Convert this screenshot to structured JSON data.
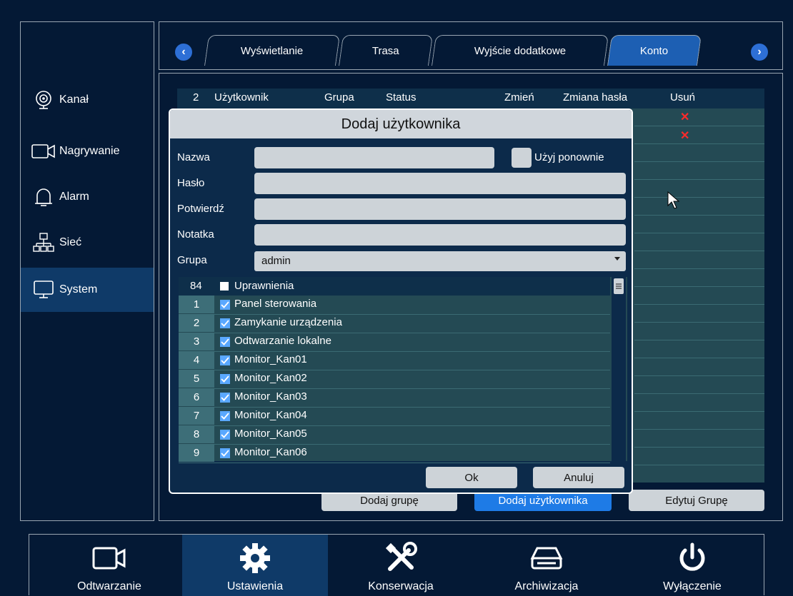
{
  "sidebar": {
    "items": [
      {
        "label": "Kanał",
        "icon": "camera-lens-icon"
      },
      {
        "label": "Nagrywanie",
        "icon": "video-camera-icon"
      },
      {
        "label": "Alarm",
        "icon": "bell-icon"
      },
      {
        "label": "Sieć",
        "icon": "network-icon"
      },
      {
        "label": "System",
        "icon": "monitor-icon",
        "active": true
      }
    ]
  },
  "tabs": {
    "prev": "‹",
    "next": "›",
    "items": [
      "Wyświetlanie",
      "Trasa",
      "Wyjście dodatkowe",
      "Konto"
    ],
    "active": "Konto"
  },
  "user_table": {
    "count": "2",
    "headers": [
      "Użytkownik",
      "Grupa",
      "Status",
      "Zmień",
      "Zmiana hasła",
      "Usuń"
    ],
    "delete_mark": "✕"
  },
  "bottom_buttons": {
    "add_group": "Dodaj grupę",
    "add_user": "Dodaj użytkownika",
    "edit_group": "Edytuj Grupę"
  },
  "dialog": {
    "title": "Dodaj użytkownika",
    "name_label": "Nazwa",
    "name_value": "",
    "reuse_label": "Użyj ponownie",
    "password_label": "Hasło",
    "confirm_label": "Potwierdź",
    "note_label": "Notatka",
    "group_label": "Grupa",
    "group_value": "admin",
    "permissions": {
      "count": "84",
      "header": "Uprawnienia",
      "rows": [
        {
          "num": "1",
          "label": "Panel sterowania"
        },
        {
          "num": "2",
          "label": "Zamykanie urządzenia"
        },
        {
          "num": "3",
          "label": "Odtwarzanie lokalne"
        },
        {
          "num": "4",
          "label": "Monitor_Kan01"
        },
        {
          "num": "5",
          "label": "Monitor_Kan02"
        },
        {
          "num": "6",
          "label": "Monitor_Kan03"
        },
        {
          "num": "7",
          "label": "Monitor_Kan04"
        },
        {
          "num": "8",
          "label": "Monitor_Kan05"
        },
        {
          "num": "9",
          "label": "Monitor_Kan06"
        }
      ]
    },
    "ok": "Ok",
    "cancel": "Anuluj"
  },
  "taskbar": {
    "items": [
      {
        "label": "Odtwarzanie",
        "icon": "video-camera-icon"
      },
      {
        "label": "Ustawienia",
        "icon": "gear-icon",
        "active": true
      },
      {
        "label": "Konserwacja",
        "icon": "tools-icon"
      },
      {
        "label": "Archiwizacja",
        "icon": "drive-icon"
      },
      {
        "label": "Wyłączenie",
        "icon": "power-icon"
      }
    ]
  },
  "colors": {
    "background": "#041935",
    "active": "#0f3a68",
    "accent": "#1d5fb3",
    "table": "#244a54",
    "delete": "#ff2a2a"
  }
}
